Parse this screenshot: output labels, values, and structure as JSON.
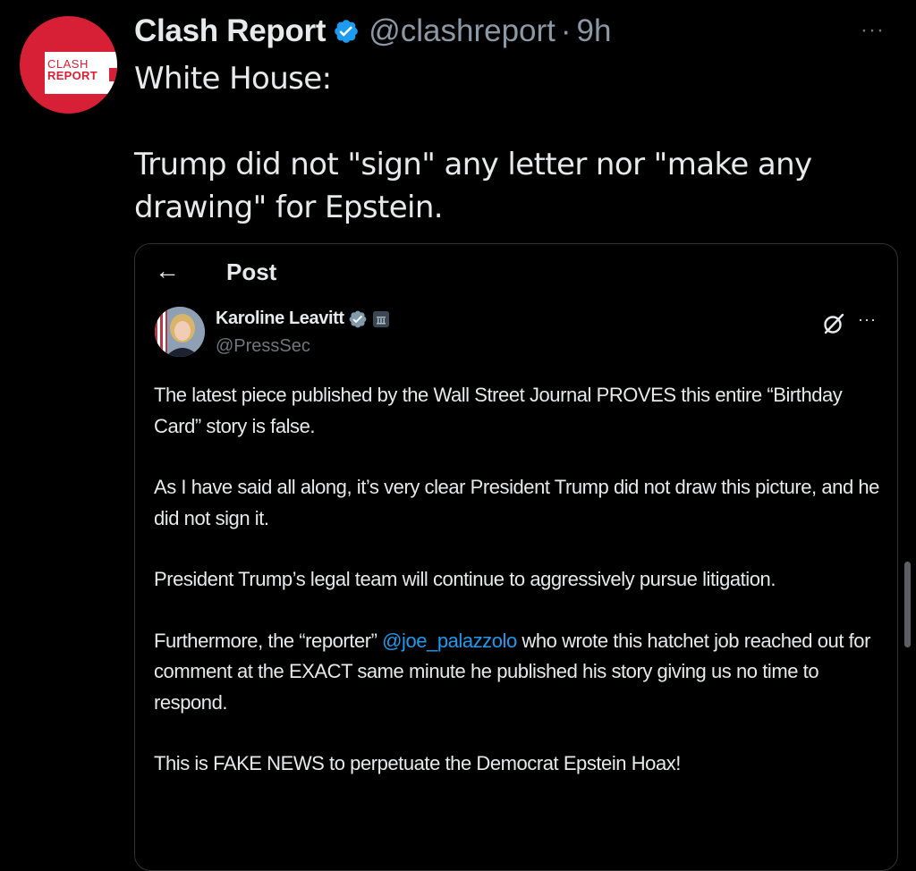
{
  "tweet": {
    "author_name": "Clash Report",
    "handle": "@clashreport",
    "separator": "·",
    "time": "9h",
    "avatar_logo_line1": "CLASH",
    "avatar_logo_line2": "REPORT",
    "text": "White House:\n\nTrump did not \"sign\" any letter nor \"make any drawing\" for Epstein.",
    "more_icon": "more-horizontal-icon",
    "verified_color": "#1d9bf0",
    "avatar_color": "#d71f35"
  },
  "quote": {
    "header_title": "Post",
    "back_icon": "arrow-left-icon",
    "back_glyph": "←",
    "author_name": "Karoline Leavitt",
    "handle": "@PressSec",
    "verified_color": "#829aab",
    "more_glyph": "···",
    "paragraphs": [
      {
        "text": "The latest piece published by the Wall Street Journal PROVES this entire “Birthday Card” story is false."
      },
      {
        "text": "As I have said all along, it’s very clear President Trump did not draw this picture, and he did not sign it."
      },
      {
        "text": "President Trump’s legal team will continue to aggressively pursue litigation."
      },
      {
        "before": "Furthermore, the “reporter” ",
        "mention": "@joe_palazzolo",
        "after": " who wrote this hatchet job reached out for comment at the EXACT same minute he published his story giving us no time to respond."
      },
      {
        "text": "This is FAKE NEWS to perpetuate the Democrat Epstein Hoax!"
      }
    ],
    "mention_color": "#1d9bf0"
  },
  "ui": {
    "more_glyph": "···"
  }
}
